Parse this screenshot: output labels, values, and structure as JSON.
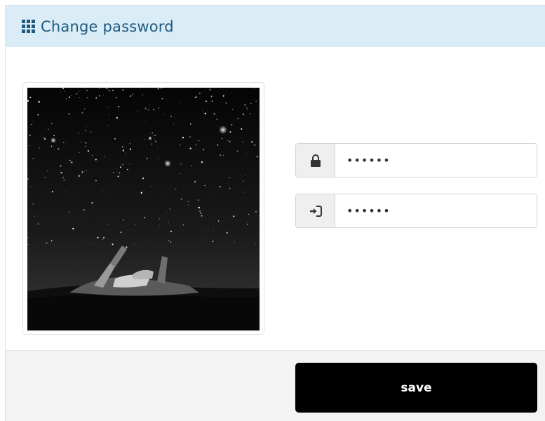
{
  "header": {
    "icon": "grid-icon",
    "title": "Change password"
  },
  "photo": {
    "description_icon": "starry-night-photo"
  },
  "form": {
    "current_password": {
      "icon": "lock-icon",
      "value": "••••••"
    },
    "new_password": {
      "icon": "sign-in-icon",
      "value": "••••••"
    }
  },
  "footer": {
    "save_label": "save"
  },
  "colors": {
    "header_bg": "#daecf6",
    "header_text": "#1f5a80",
    "button_bg": "#000000",
    "footer_bg": "#f3f3f3"
  }
}
